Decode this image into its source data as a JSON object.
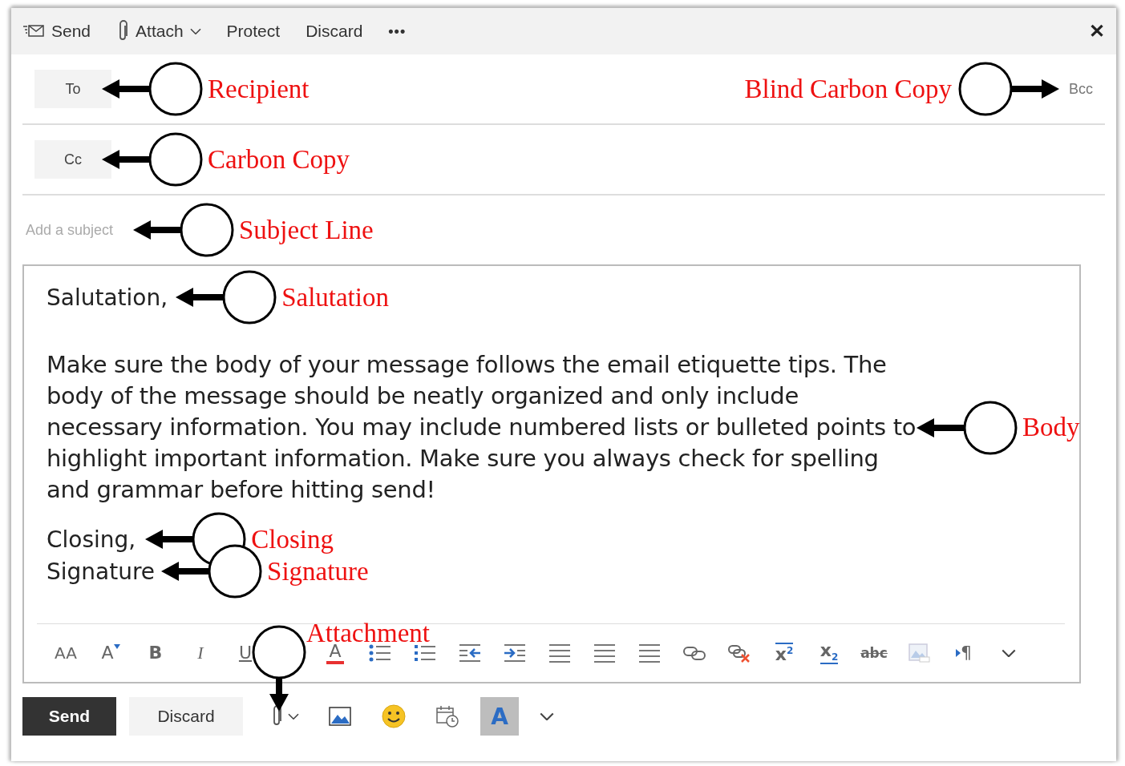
{
  "command_bar": {
    "items": [
      {
        "kind": "send",
        "label": "Send"
      },
      {
        "kind": "attach",
        "label": "Attach"
      },
      {
        "kind": "plain",
        "label": "Protect"
      },
      {
        "kind": "plain",
        "label": "Discard"
      },
      {
        "kind": "more",
        "label": "•••"
      }
    ],
    "close": "✕"
  },
  "to": {
    "label": "To",
    "annotation": "Recipient"
  },
  "bcc": {
    "label": "Bcc",
    "annotation": "Blind Carbon Copy"
  },
  "cc": {
    "label": "Cc",
    "annotation": "Carbon Copy"
  },
  "subject": {
    "placeholder": "Add a subject",
    "annotation": "Subject Line"
  },
  "body": {
    "salutation": "Salutation,",
    "salutation_annotation": "Salutation",
    "paragraph": "Make sure the body of your message follows the email etiquette tips. The body of the message should be neatly organized and only include necessary information. You may include numbered lists or bulleted points to highlight important information. Make sure you always check for spelling and grammar before hitting send!",
    "paragraph_annotation": "Body",
    "closing": "Closing,",
    "closing_annotation": "Closing",
    "signature": "Signature",
    "signature_annotation": "Signature"
  },
  "format_toolbar": [
    {
      "kind": "font-size",
      "text": "AA"
    },
    {
      "kind": "grow-font",
      "text": "A"
    },
    {
      "kind": "bold",
      "text": "B"
    },
    {
      "kind": "italic",
      "text": "I"
    },
    {
      "kind": "underline",
      "text": "U"
    },
    {
      "kind": "font-color",
      "text": "A"
    },
    {
      "kind": "bullets"
    },
    {
      "kind": "numbering"
    },
    {
      "kind": "outdent"
    },
    {
      "kind": "indent"
    },
    {
      "kind": "align-left"
    },
    {
      "kind": "align-center"
    },
    {
      "kind": "align-right"
    },
    {
      "kind": "link"
    },
    {
      "kind": "unlink"
    },
    {
      "kind": "superscript",
      "text": "x",
      "small": "2"
    },
    {
      "kind": "subscript",
      "text": "x",
      "small": "2"
    },
    {
      "kind": "strikethrough",
      "text": "abc"
    },
    {
      "kind": "image"
    },
    {
      "kind": "ltr",
      "text": "¶"
    },
    {
      "kind": "more"
    }
  ],
  "attachment_annotation": "Attachment",
  "footer": {
    "send": "Send",
    "discard": "Discard",
    "tools": [
      {
        "kind": "attach"
      },
      {
        "kind": "image"
      },
      {
        "kind": "emoji"
      },
      {
        "kind": "calendar"
      },
      {
        "kind": "format",
        "text": "A",
        "selected": true
      },
      {
        "kind": "more"
      }
    ]
  }
}
